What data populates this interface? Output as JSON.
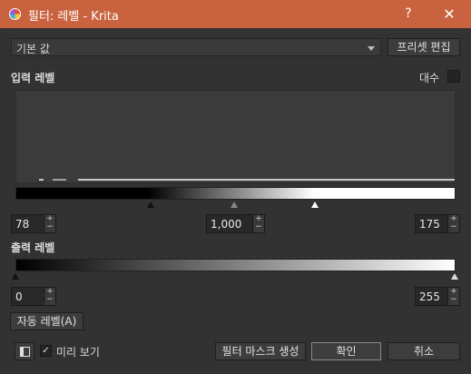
{
  "window": {
    "title": "필터: 레벨 - Krita",
    "help_label": "?",
    "close_label": "✕"
  },
  "preset": {
    "selected": "기본 값",
    "edit_label": "프리셋 편집"
  },
  "input_levels": {
    "label": "입력 레벨",
    "logarithmic_label": "대수",
    "logarithmic_checked": false,
    "black_point": "78",
    "gamma": "1,000",
    "white_point": "175"
  },
  "output_levels": {
    "label": "출력 레벨",
    "black_point": "0",
    "white_point": "255"
  },
  "spin_arrows": {
    "up": "+",
    "down": "−"
  },
  "auto_levels_label": "자동 레벨(A)",
  "footer": {
    "preview_label": "미리 보기",
    "preview_checked": true,
    "preview_check_glyph": "✓",
    "create_mask_label": "필터 마스크 생성",
    "ok_label": "확인",
    "cancel_label": "취소"
  },
  "icons": {
    "app": "krita-icon",
    "toggle": "split-view-icon",
    "dropdown": "chevron-down-icon"
  }
}
